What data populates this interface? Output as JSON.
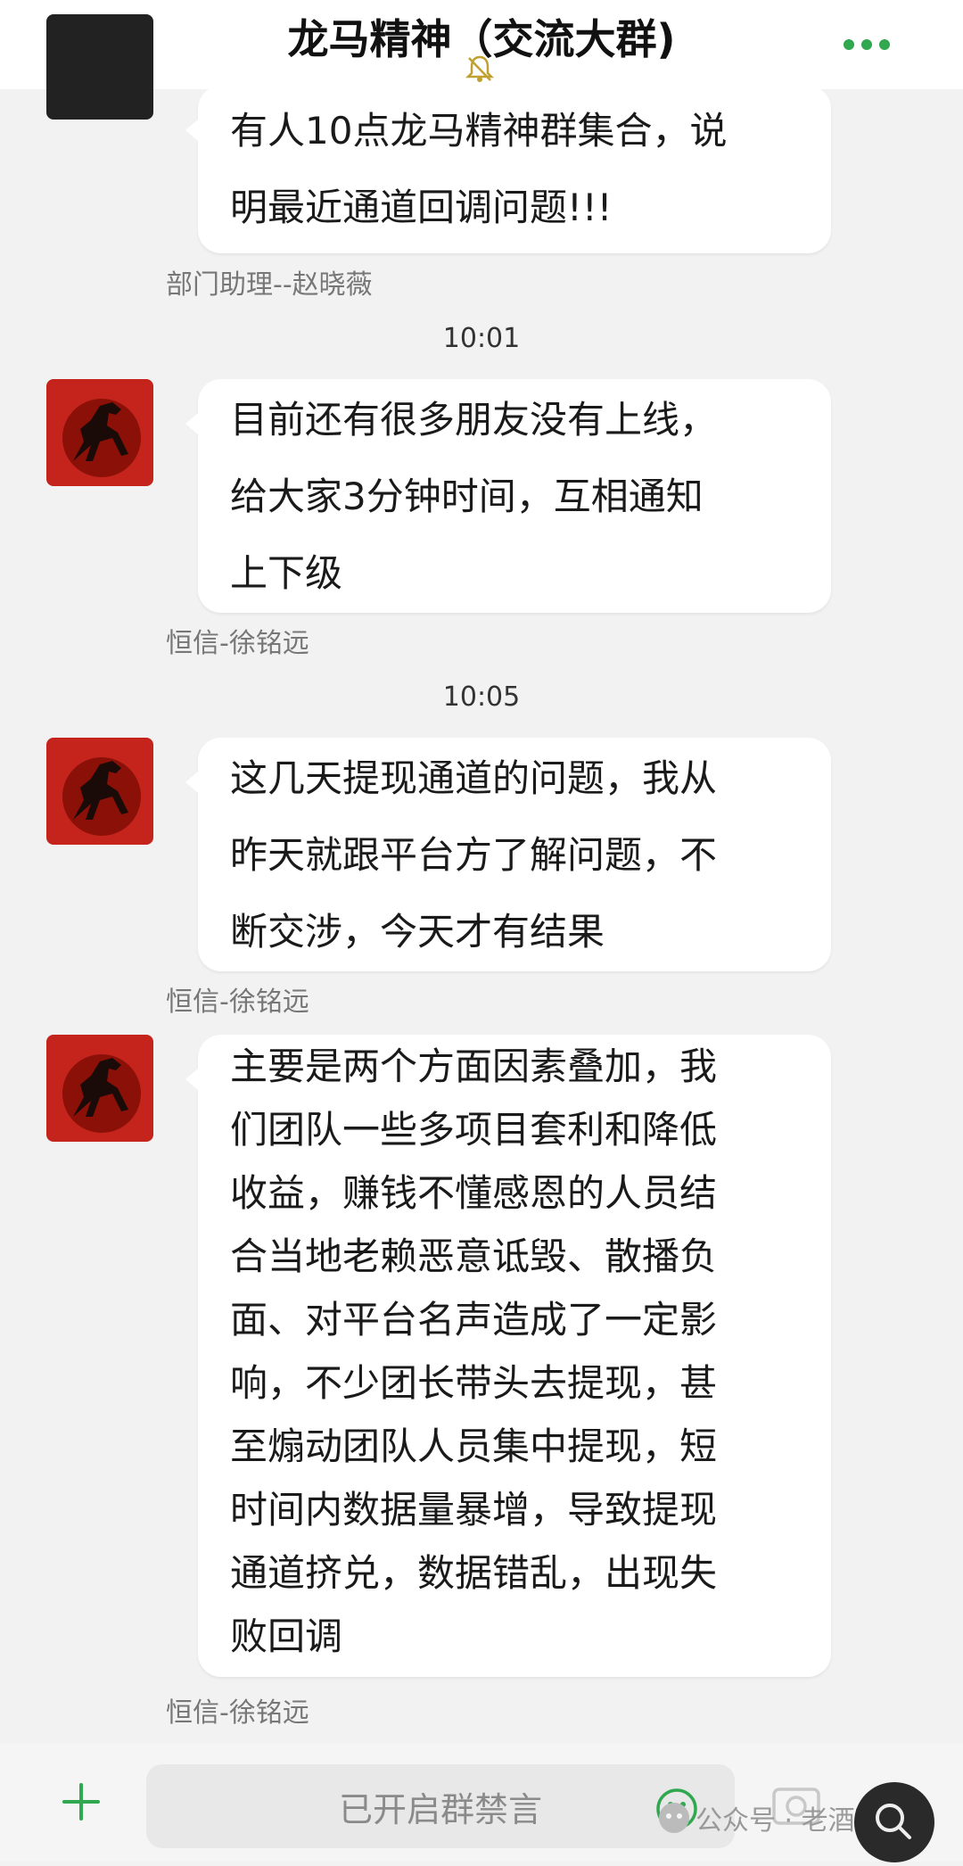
{
  "header": {
    "title": "龙马精神（交流大群)"
  },
  "messages": [
    {
      "text": "有人10点龙马精神群集合，说\n明最近通道回调问题!!!",
      "sender": "部门助理--赵晓薇"
    },
    {
      "time": "10:01",
      "text": "目前还有很多朋友没有上线，\n给大家3分钟时间，互相通知\n上下级",
      "sender": "恒信-徐铭远"
    },
    {
      "time": "10:05",
      "text": "这几天提现通道的问题，我从\n昨天就跟平台方了解问题，不\n断交涉，今天才有结果",
      "sender": "恒信-徐铭远"
    },
    {
      "text": "主要是两个方面因素叠加，我\n们团队一些多项目套利和降低\n收益，赚钱不懂感恩的人员结\n合当地老赖恶意诋毁、散播负\n面、对平台名声造成了一定影\n响，不少团长带头去提现，甚\n至煽动团队人员集中提现，短\n时间内数据量暴增，导致提现\n通道挤兑，数据错乱，出现失\n败回调",
      "sender": "恒信-徐铭远"
    }
  ],
  "composer": {
    "muted_label": "已开启群禁言"
  },
  "watermark": "公众号 · 老酒理盘",
  "colors": {
    "accent": "#2fa84f",
    "background": "#f2f2f2",
    "bubble": "#ffffff",
    "avatar_red": "#c4241b"
  }
}
